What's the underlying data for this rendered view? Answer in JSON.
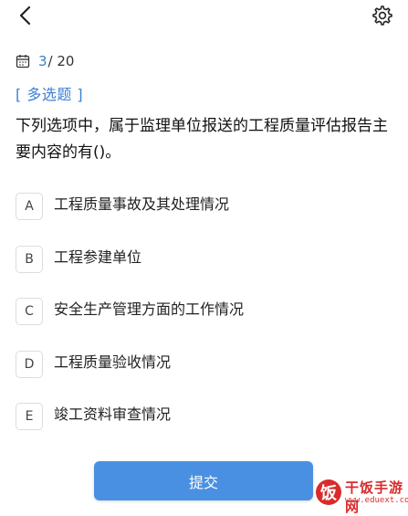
{
  "header": {
    "back_icon": "chevron-left-icon",
    "settings_icon": "gear-icon"
  },
  "progress": {
    "current": "3",
    "total": "/ 20",
    "icon": "calendar-icon"
  },
  "question": {
    "type_label": "[ 多选题 ]",
    "text": "下列选项中，属于监理单位报送的工程质量评估报告主要内容的有()。"
  },
  "options": [
    {
      "key": "A",
      "text": "工程质量事故及其处理情况"
    },
    {
      "key": "B",
      "text": "工程参建单位"
    },
    {
      "key": "C",
      "text": "安全生产管理方面的工作情况"
    },
    {
      "key": "D",
      "text": "工程质量验收情况"
    },
    {
      "key": "E",
      "text": "竣工资料审查情况"
    }
  ],
  "submit_label": "提交",
  "watermark": {
    "logo": "饭",
    "name": "干饭手游网",
    "url": "www.eduext.com"
  },
  "colors": {
    "accent": "#3b7fd6",
    "button": "#4a90e2",
    "watermark": "#d92b2b"
  }
}
